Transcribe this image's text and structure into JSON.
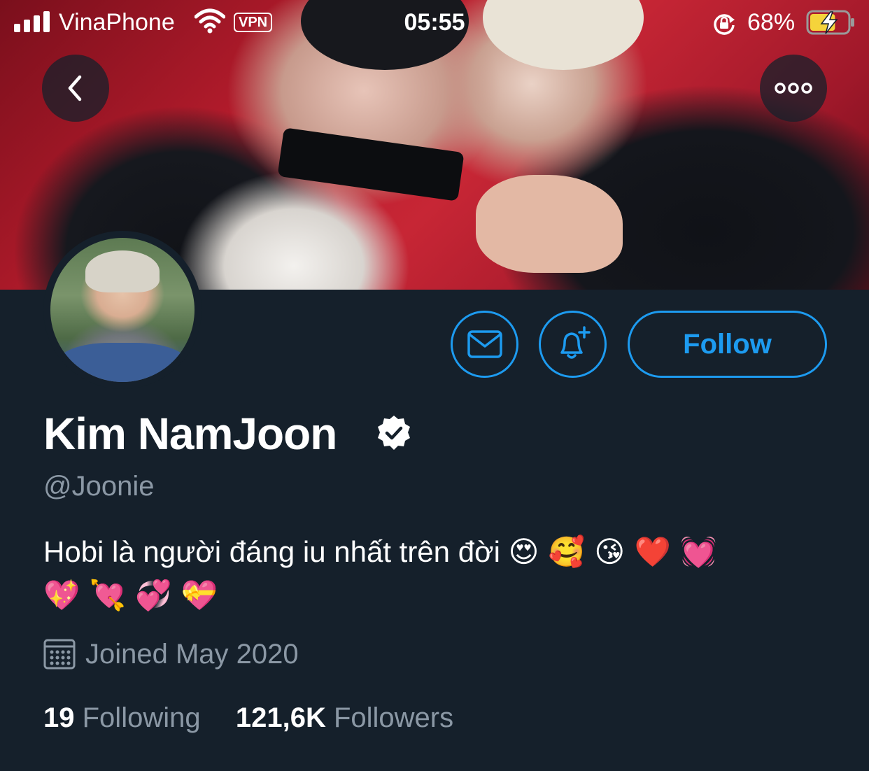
{
  "status_bar": {
    "carrier": "VinaPhone",
    "vpn": "VPN",
    "time": "05:55",
    "battery_percent": "68%",
    "battery_level": 0.68
  },
  "header": {
    "back_icon": "chevron-left-icon",
    "more_icon": "more-dots-icon"
  },
  "profile": {
    "display_name": "Kim NamJoon",
    "verified": true,
    "handle": "@Joonie",
    "bio_text": "Hobi là người đáng iu nhất trên đời",
    "bio_emoji_line1": "😍 🥰 😘 ❤️ 💓",
    "bio_emoji_line2": "💖 💘 💞 💝",
    "joined": "Joined May 2020",
    "following_count": "19",
    "following_label": "Following",
    "followers_count": "121,6K",
    "followers_label": "Followers"
  },
  "actions": {
    "follow_label": "Follow",
    "message_icon": "envelope-icon",
    "notify_icon": "bell-plus-icon"
  },
  "colors": {
    "background": "#15202b",
    "accent": "#1d9bf0",
    "secondary_text": "#8b98a5"
  }
}
